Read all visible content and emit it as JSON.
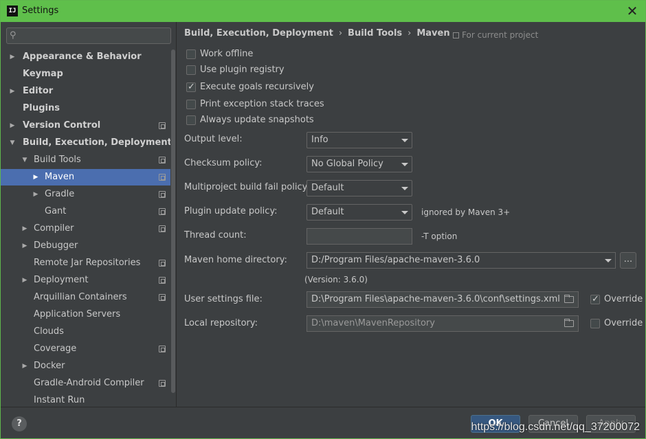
{
  "window": {
    "title": "Settings",
    "logo_text": "IJ"
  },
  "sidebar": {
    "search_placeholder": "",
    "items": [
      {
        "label": "Appearance & Behavior",
        "bold": true,
        "arrow": "▶",
        "indent": 0,
        "project": false
      },
      {
        "label": "Keymap",
        "bold": true,
        "arrow": "",
        "indent": 0,
        "project": false
      },
      {
        "label": "Editor",
        "bold": true,
        "arrow": "▶",
        "indent": 0,
        "project": false
      },
      {
        "label": "Plugins",
        "bold": true,
        "arrow": "",
        "indent": 0,
        "project": false
      },
      {
        "label": "Version Control",
        "bold": true,
        "arrow": "▶",
        "indent": 0,
        "project": true
      },
      {
        "label": "Build, Execution, Deployment",
        "bold": true,
        "arrow": "▼",
        "indent": 0,
        "project": false
      },
      {
        "label": "Build Tools",
        "bold": false,
        "arrow": "▼",
        "indent": 1,
        "project": true
      },
      {
        "label": "Maven",
        "bold": false,
        "arrow": "▶",
        "indent": 2,
        "project": true,
        "selected": true
      },
      {
        "label": "Gradle",
        "bold": false,
        "arrow": "▶",
        "indent": 2,
        "project": true
      },
      {
        "label": "Gant",
        "bold": false,
        "arrow": "",
        "indent": 2,
        "project": true
      },
      {
        "label": "Compiler",
        "bold": false,
        "arrow": "▶",
        "indent": 1,
        "project": true
      },
      {
        "label": "Debugger",
        "bold": false,
        "arrow": "▶",
        "indent": 1,
        "project": false
      },
      {
        "label": "Remote Jar Repositories",
        "bold": false,
        "arrow": "",
        "indent": 1,
        "project": true
      },
      {
        "label": "Deployment",
        "bold": false,
        "arrow": "▶",
        "indent": 1,
        "project": true
      },
      {
        "label": "Arquillian Containers",
        "bold": false,
        "arrow": "",
        "indent": 1,
        "project": true
      },
      {
        "label": "Application Servers",
        "bold": false,
        "arrow": "",
        "indent": 1,
        "project": false
      },
      {
        "label": "Clouds",
        "bold": false,
        "arrow": "",
        "indent": 1,
        "project": false
      },
      {
        "label": "Coverage",
        "bold": false,
        "arrow": "",
        "indent": 1,
        "project": true
      },
      {
        "label": "Docker",
        "bold": false,
        "arrow": "▶",
        "indent": 1,
        "project": false
      },
      {
        "label": "Gradle-Android Compiler",
        "bold": false,
        "arrow": "",
        "indent": 1,
        "project": true
      },
      {
        "label": "Instant Run",
        "bold": false,
        "arrow": "",
        "indent": 1,
        "project": false
      }
    ]
  },
  "main": {
    "breadcrumb": [
      "Build, Execution, Deployment",
      "Build Tools",
      "Maven"
    ],
    "for_current_project": "For current project",
    "checkboxes": [
      {
        "label": "Work offline",
        "checked": false
      },
      {
        "label": "Use plugin registry",
        "checked": false
      },
      {
        "label": "Execute goals recursively",
        "checked": true
      },
      {
        "label": "Print exception stack traces",
        "checked": false
      },
      {
        "label": "Always update snapshots",
        "checked": false
      }
    ],
    "output_level": {
      "label": "Output level:",
      "value": "Info"
    },
    "checksum_policy": {
      "label": "Checksum policy:",
      "value": "No Global Policy"
    },
    "multiproject_fail_policy": {
      "label": "Multiproject build fail policy:",
      "value": "Default"
    },
    "plugin_update_policy": {
      "label": "Plugin update policy:",
      "value": "Default",
      "hint": "ignored by Maven 3+"
    },
    "thread_count": {
      "label": "Thread count:",
      "value": "",
      "hint": "-T option"
    },
    "maven_home": {
      "label": "Maven home directory:",
      "value": "D:/Program Files/apache-maven-3.6.0",
      "version": "(Version: 3.6.0)",
      "browse_label": "..."
    },
    "user_settings": {
      "label": "User settings file:",
      "value": "D:\\Program Files\\apache-maven-3.6.0\\conf\\settings.xml",
      "override_label": "Override",
      "override_checked": true
    },
    "local_repo": {
      "label": "Local repository:",
      "value": "D:\\maven\\MavenRepository",
      "override_label": "Override",
      "override_checked": false
    }
  },
  "footer": {
    "help_label": "?",
    "ok_label": "OK",
    "cancel_label": "Cancel",
    "apply_label": "Apply",
    "watermark": "https://blog.csdn.net/qq_37200072"
  },
  "colors": {
    "title_bar": "#5fbf4b",
    "selection": "#4b6eaf",
    "background": "#3c3f41"
  }
}
